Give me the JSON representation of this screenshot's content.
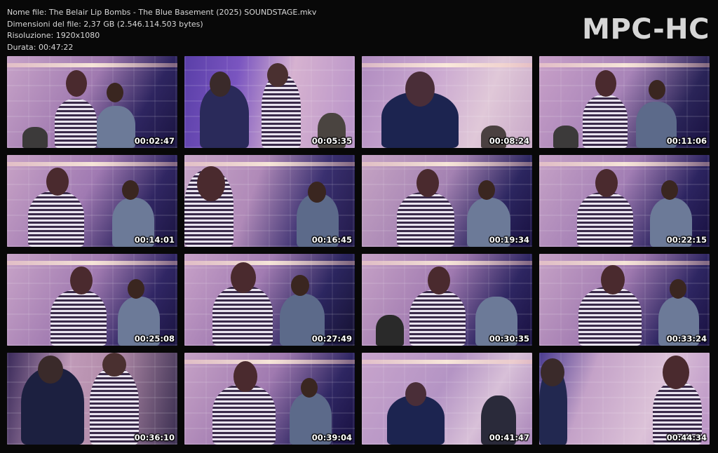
{
  "header": {
    "lines": [
      "Nome file: The Belair Lip Bombs - The Blue Basement (2025) SOUNDSTAGE.mkv",
      "Dimensioni del file: 2,37 GB (2.546.114.503 bytes)",
      "Risoluzione: 1920x1080",
      "Durata: 00:47:22"
    ],
    "brand": "MPC-HC"
  },
  "thumbnails": [
    {
      "time": "00:02:47"
    },
    {
      "time": "00:05:35"
    },
    {
      "time": "00:08:24"
    },
    {
      "time": "00:11:06"
    },
    {
      "time": "00:14:01"
    },
    {
      "time": "00:16:45"
    },
    {
      "time": "00:19:34"
    },
    {
      "time": "00:22:15"
    },
    {
      "time": "00:25:08"
    },
    {
      "time": "00:27:49"
    },
    {
      "time": "00:30:35"
    },
    {
      "time": "00:33:24"
    },
    {
      "time": "00:36:10"
    },
    {
      "time": "00:39:04"
    },
    {
      "time": "00:41:47"
    },
    {
      "time": "00:44:34"
    }
  ]
}
